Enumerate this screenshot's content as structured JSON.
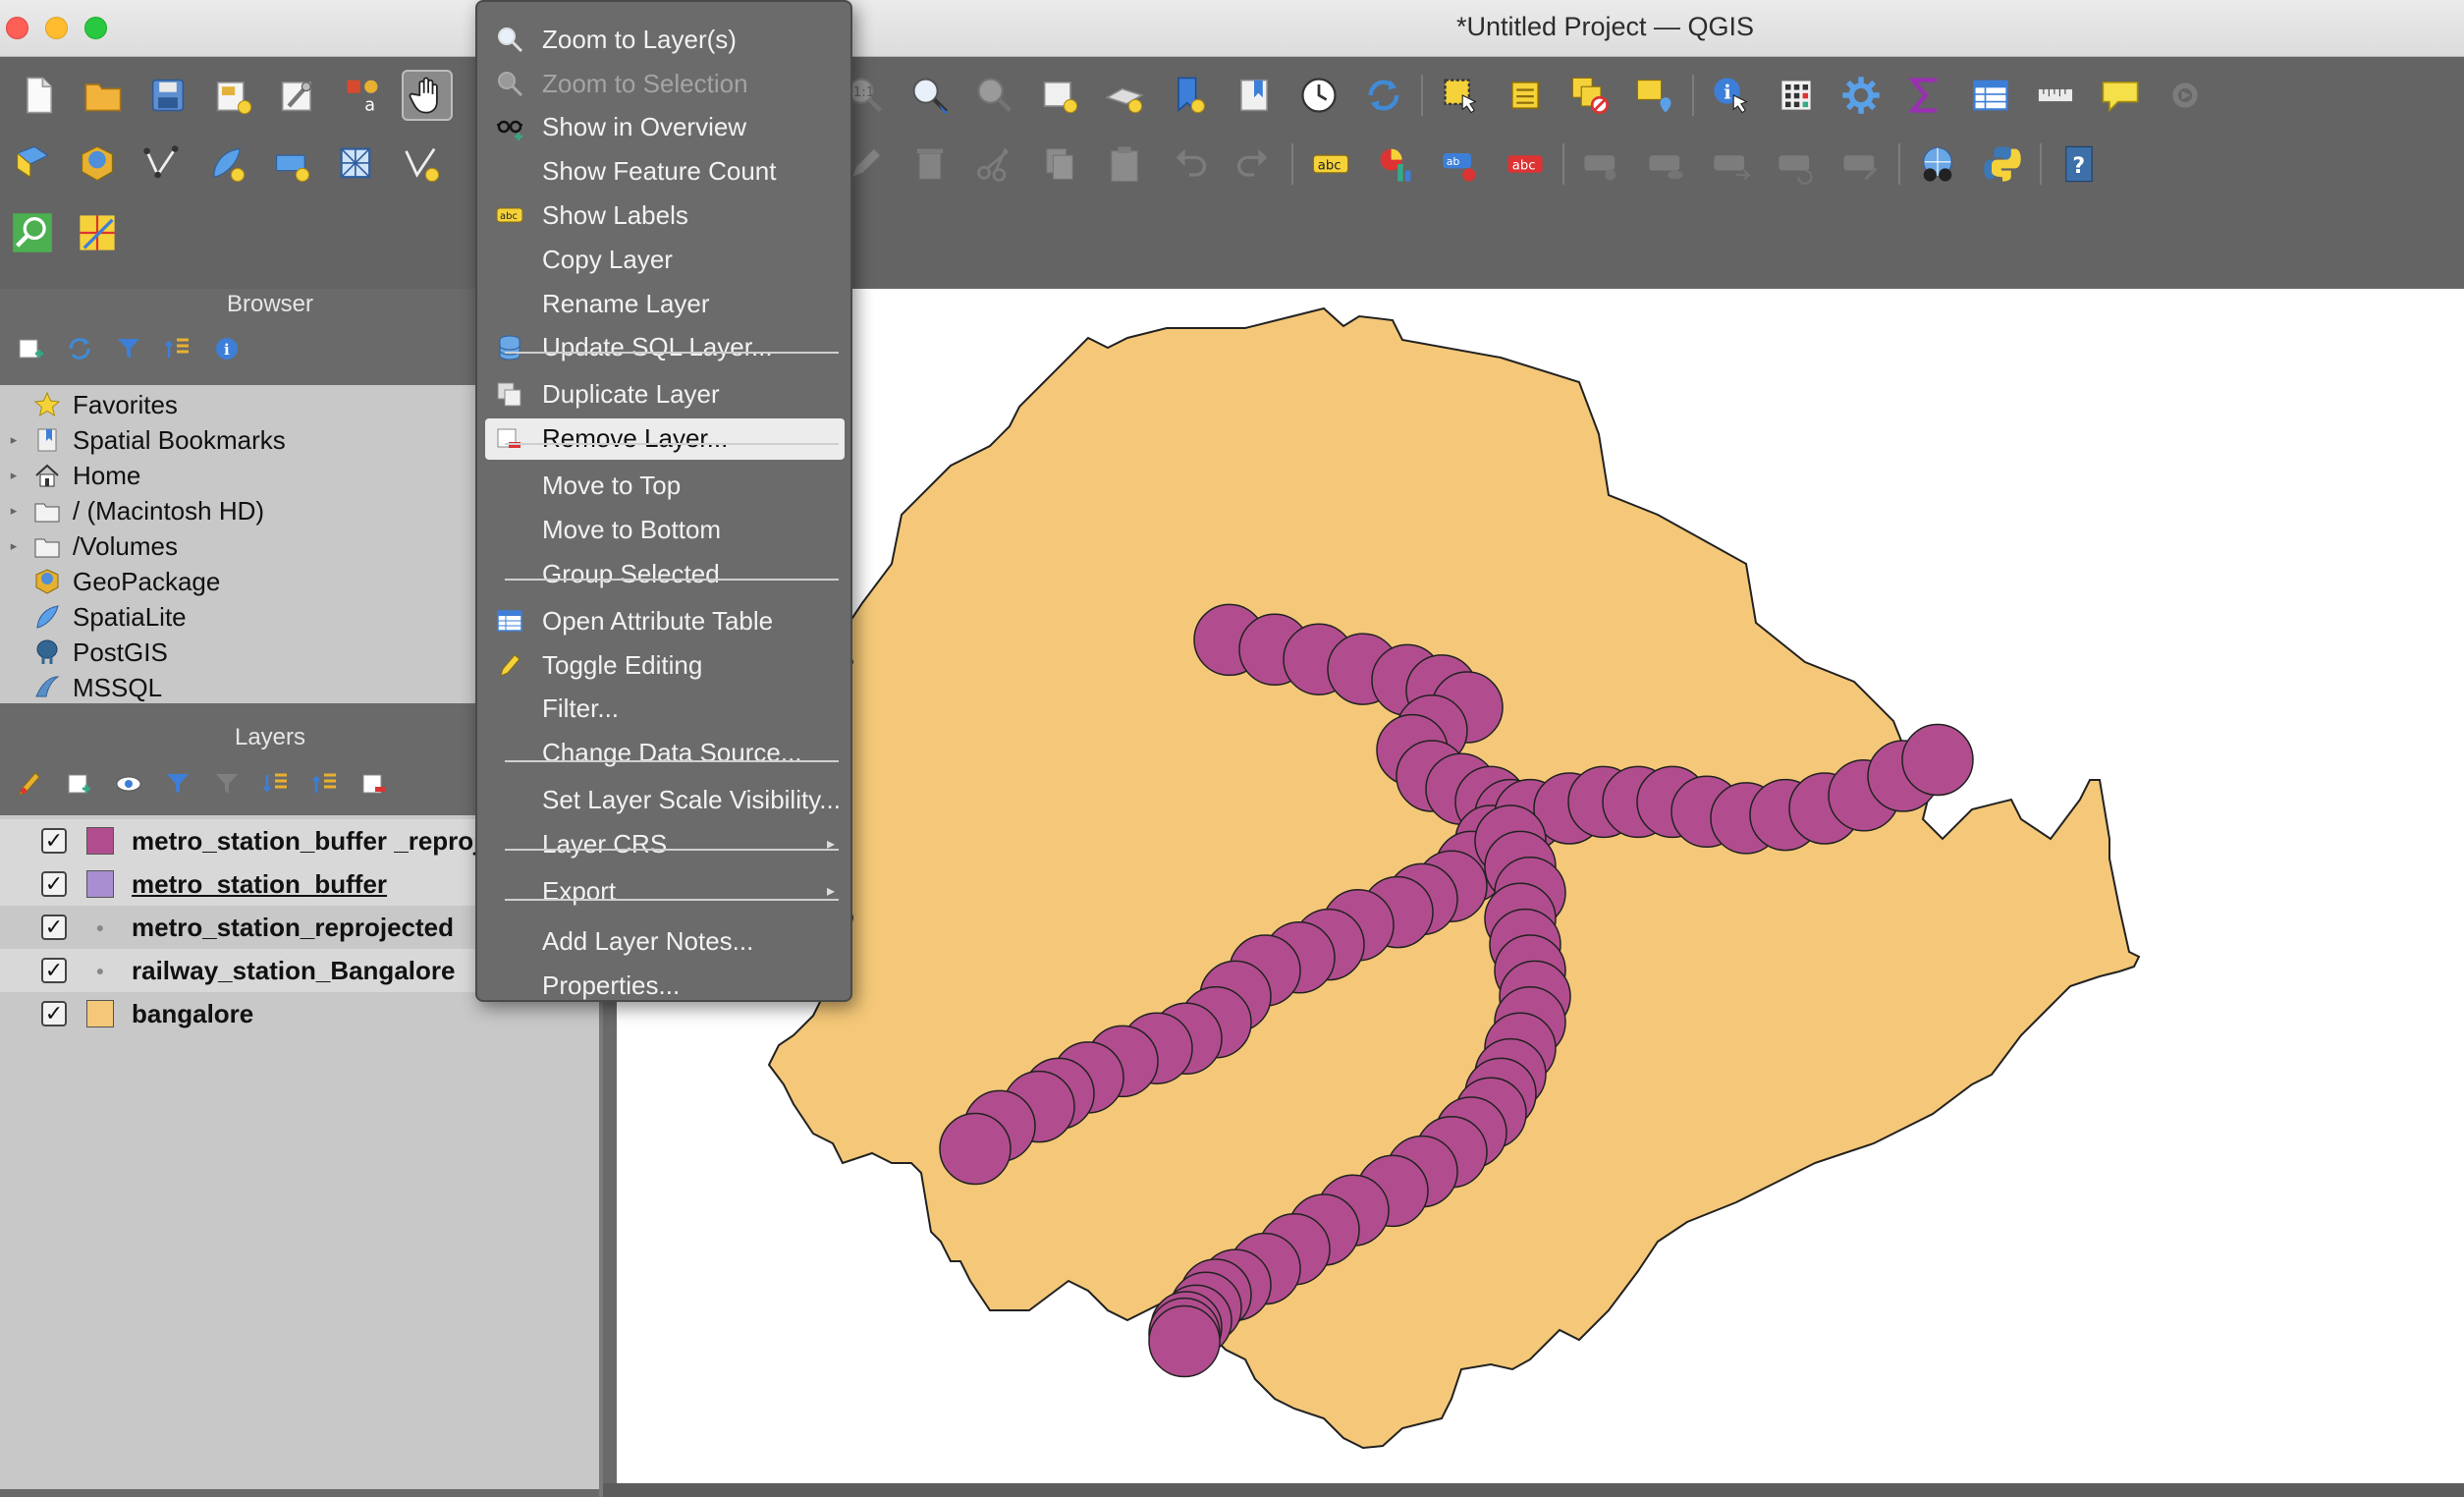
{
  "window": {
    "title": "*Untitled Project — QGIS"
  },
  "browser": {
    "title": "Browser",
    "items": [
      {
        "label": "Favorites",
        "icon": "star-icon",
        "arrow": ""
      },
      {
        "label": "Spatial Bookmarks",
        "icon": "bookmark-icon",
        "arrow": "▸"
      },
      {
        "label": "Home",
        "icon": "home-icon",
        "arrow": "▸"
      },
      {
        "label": "/ (Macintosh HD)",
        "icon": "folder-icon",
        "arrow": "▸"
      },
      {
        "label": "/Volumes",
        "icon": "folder-icon",
        "arrow": "▸"
      },
      {
        "label": "GeoPackage",
        "icon": "geopackage-icon",
        "arrow": ""
      },
      {
        "label": "SpatiaLite",
        "icon": "spatialite-icon",
        "arrow": ""
      },
      {
        "label": "PostGIS",
        "icon": "postgis-icon",
        "arrow": ""
      },
      {
        "label": "MSSQL",
        "icon": "mssql-icon",
        "arrow": ""
      }
    ]
  },
  "layers": {
    "title": "Layers",
    "items": [
      {
        "name": "metro_station_buffer _reprojected",
        "checked": "✓",
        "color": "#b14d8e",
        "type": "polygon"
      },
      {
        "name": "metro_station_buffer",
        "checked": "✓",
        "color": "#a78fd1",
        "type": "polygon"
      },
      {
        "name": "metro_station_reprojected",
        "checked": "✓",
        "type": "point"
      },
      {
        "name": "railway_station_Bangalore",
        "checked": "✓",
        "type": "point"
      },
      {
        "name": "bangalore",
        "checked": "✓",
        "color": "#f4c878",
        "type": "polygon"
      }
    ]
  },
  "context_menu": {
    "items": [
      {
        "label": "Zoom to Layer(s)",
        "icon": "zoom-layer-icon"
      },
      {
        "label": "Zoom to Selection",
        "icon": "zoom-selection-icon",
        "disabled": true
      },
      {
        "label": "Show in Overview",
        "icon": "overview-icon"
      },
      {
        "label": "Show Feature Count"
      },
      {
        "label": "Show Labels",
        "icon": "labels-icon"
      },
      {
        "label": "Copy Layer"
      },
      {
        "label": "Rename Layer"
      },
      {
        "label": "Update SQL Layer...",
        "icon": "database-icon"
      },
      {
        "label": "Duplicate Layer",
        "icon": "duplicate-icon"
      },
      {
        "label": "Remove Layer...",
        "icon": "remove-layer-icon",
        "highlighted": true
      },
      {
        "label": "Move to Top"
      },
      {
        "label": "Move to Bottom"
      },
      {
        "label": "Group Selected"
      },
      {
        "label": "Open Attribute Table",
        "icon": "attribute-table-icon"
      },
      {
        "label": "Toggle Editing",
        "icon": "pencil-icon"
      },
      {
        "label": "Filter..."
      },
      {
        "label": "Change Data Source..."
      },
      {
        "label": "Set Layer Scale Visibility..."
      },
      {
        "label": "Layer CRS",
        "submenu": "▸"
      },
      {
        "label": "Export",
        "submenu": "▸"
      },
      {
        "label": "Add Layer Notes..."
      },
      {
        "label": "Properties..."
      }
    ]
  },
  "map": {
    "layers_drawn": [
      "bangalore",
      "metro_station_buffer _reprojected"
    ],
    "colors": {
      "boundary_fill": "#f4c878",
      "buffer_fill": "#b14d8e",
      "outline": "#222222",
      "canvas_bg": "#ffffff"
    }
  },
  "theme": {
    "toolbar_bg": "#646464",
    "panel_bg": "#c8c8c8",
    "menu_bg": "#6b6b6b",
    "menu_highlight": "#ececec"
  }
}
